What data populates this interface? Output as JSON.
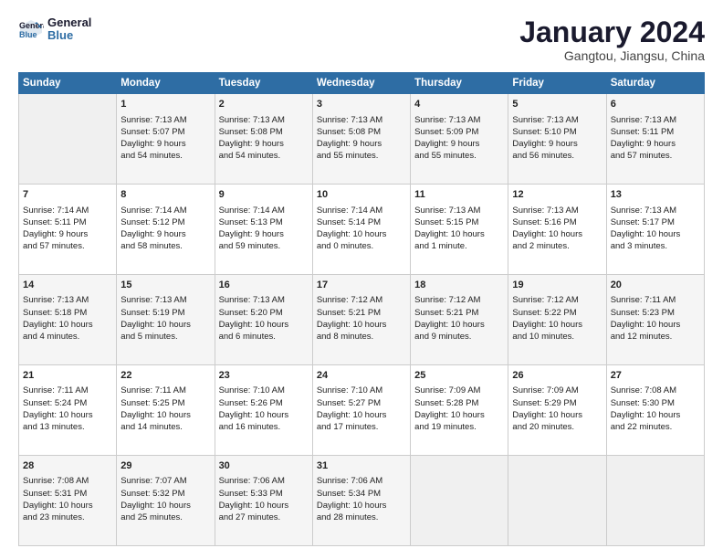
{
  "header": {
    "logo_line1": "General",
    "logo_line2": "Blue",
    "title": "January 2024",
    "subtitle": "Gangtou, Jiangsu, China"
  },
  "columns": [
    "Sunday",
    "Monday",
    "Tuesday",
    "Wednesday",
    "Thursday",
    "Friday",
    "Saturday"
  ],
  "weeks": [
    [
      {
        "day": "",
        "lines": []
      },
      {
        "day": "1",
        "lines": [
          "Sunrise: 7:13 AM",
          "Sunset: 5:07 PM",
          "Daylight: 9 hours",
          "and 54 minutes."
        ]
      },
      {
        "day": "2",
        "lines": [
          "Sunrise: 7:13 AM",
          "Sunset: 5:08 PM",
          "Daylight: 9 hours",
          "and 54 minutes."
        ]
      },
      {
        "day": "3",
        "lines": [
          "Sunrise: 7:13 AM",
          "Sunset: 5:08 PM",
          "Daylight: 9 hours",
          "and 55 minutes."
        ]
      },
      {
        "day": "4",
        "lines": [
          "Sunrise: 7:13 AM",
          "Sunset: 5:09 PM",
          "Daylight: 9 hours",
          "and 55 minutes."
        ]
      },
      {
        "day": "5",
        "lines": [
          "Sunrise: 7:13 AM",
          "Sunset: 5:10 PM",
          "Daylight: 9 hours",
          "and 56 minutes."
        ]
      },
      {
        "day": "6",
        "lines": [
          "Sunrise: 7:13 AM",
          "Sunset: 5:11 PM",
          "Daylight: 9 hours",
          "and 57 minutes."
        ]
      }
    ],
    [
      {
        "day": "7",
        "lines": [
          "Sunrise: 7:14 AM",
          "Sunset: 5:11 PM",
          "Daylight: 9 hours",
          "and 57 minutes."
        ]
      },
      {
        "day": "8",
        "lines": [
          "Sunrise: 7:14 AM",
          "Sunset: 5:12 PM",
          "Daylight: 9 hours",
          "and 58 minutes."
        ]
      },
      {
        "day": "9",
        "lines": [
          "Sunrise: 7:14 AM",
          "Sunset: 5:13 PM",
          "Daylight: 9 hours",
          "and 59 minutes."
        ]
      },
      {
        "day": "10",
        "lines": [
          "Sunrise: 7:14 AM",
          "Sunset: 5:14 PM",
          "Daylight: 10 hours",
          "and 0 minutes."
        ]
      },
      {
        "day": "11",
        "lines": [
          "Sunrise: 7:13 AM",
          "Sunset: 5:15 PM",
          "Daylight: 10 hours",
          "and 1 minute."
        ]
      },
      {
        "day": "12",
        "lines": [
          "Sunrise: 7:13 AM",
          "Sunset: 5:16 PM",
          "Daylight: 10 hours",
          "and 2 minutes."
        ]
      },
      {
        "day": "13",
        "lines": [
          "Sunrise: 7:13 AM",
          "Sunset: 5:17 PM",
          "Daylight: 10 hours",
          "and 3 minutes."
        ]
      }
    ],
    [
      {
        "day": "14",
        "lines": [
          "Sunrise: 7:13 AM",
          "Sunset: 5:18 PM",
          "Daylight: 10 hours",
          "and 4 minutes."
        ]
      },
      {
        "day": "15",
        "lines": [
          "Sunrise: 7:13 AM",
          "Sunset: 5:19 PM",
          "Daylight: 10 hours",
          "and 5 minutes."
        ]
      },
      {
        "day": "16",
        "lines": [
          "Sunrise: 7:13 AM",
          "Sunset: 5:20 PM",
          "Daylight: 10 hours",
          "and 6 minutes."
        ]
      },
      {
        "day": "17",
        "lines": [
          "Sunrise: 7:12 AM",
          "Sunset: 5:21 PM",
          "Daylight: 10 hours",
          "and 8 minutes."
        ]
      },
      {
        "day": "18",
        "lines": [
          "Sunrise: 7:12 AM",
          "Sunset: 5:21 PM",
          "Daylight: 10 hours",
          "and 9 minutes."
        ]
      },
      {
        "day": "19",
        "lines": [
          "Sunrise: 7:12 AM",
          "Sunset: 5:22 PM",
          "Daylight: 10 hours",
          "and 10 minutes."
        ]
      },
      {
        "day": "20",
        "lines": [
          "Sunrise: 7:11 AM",
          "Sunset: 5:23 PM",
          "Daylight: 10 hours",
          "and 12 minutes."
        ]
      }
    ],
    [
      {
        "day": "21",
        "lines": [
          "Sunrise: 7:11 AM",
          "Sunset: 5:24 PM",
          "Daylight: 10 hours",
          "and 13 minutes."
        ]
      },
      {
        "day": "22",
        "lines": [
          "Sunrise: 7:11 AM",
          "Sunset: 5:25 PM",
          "Daylight: 10 hours",
          "and 14 minutes."
        ]
      },
      {
        "day": "23",
        "lines": [
          "Sunrise: 7:10 AM",
          "Sunset: 5:26 PM",
          "Daylight: 10 hours",
          "and 16 minutes."
        ]
      },
      {
        "day": "24",
        "lines": [
          "Sunrise: 7:10 AM",
          "Sunset: 5:27 PM",
          "Daylight: 10 hours",
          "and 17 minutes."
        ]
      },
      {
        "day": "25",
        "lines": [
          "Sunrise: 7:09 AM",
          "Sunset: 5:28 PM",
          "Daylight: 10 hours",
          "and 19 minutes."
        ]
      },
      {
        "day": "26",
        "lines": [
          "Sunrise: 7:09 AM",
          "Sunset: 5:29 PM",
          "Daylight: 10 hours",
          "and 20 minutes."
        ]
      },
      {
        "day": "27",
        "lines": [
          "Sunrise: 7:08 AM",
          "Sunset: 5:30 PM",
          "Daylight: 10 hours",
          "and 22 minutes."
        ]
      }
    ],
    [
      {
        "day": "28",
        "lines": [
          "Sunrise: 7:08 AM",
          "Sunset: 5:31 PM",
          "Daylight: 10 hours",
          "and 23 minutes."
        ]
      },
      {
        "day": "29",
        "lines": [
          "Sunrise: 7:07 AM",
          "Sunset: 5:32 PM",
          "Daylight: 10 hours",
          "and 25 minutes."
        ]
      },
      {
        "day": "30",
        "lines": [
          "Sunrise: 7:06 AM",
          "Sunset: 5:33 PM",
          "Daylight: 10 hours",
          "and 27 minutes."
        ]
      },
      {
        "day": "31",
        "lines": [
          "Sunrise: 7:06 AM",
          "Sunset: 5:34 PM",
          "Daylight: 10 hours",
          "and 28 minutes."
        ]
      },
      {
        "day": "",
        "lines": []
      },
      {
        "day": "",
        "lines": []
      },
      {
        "day": "",
        "lines": []
      }
    ]
  ]
}
